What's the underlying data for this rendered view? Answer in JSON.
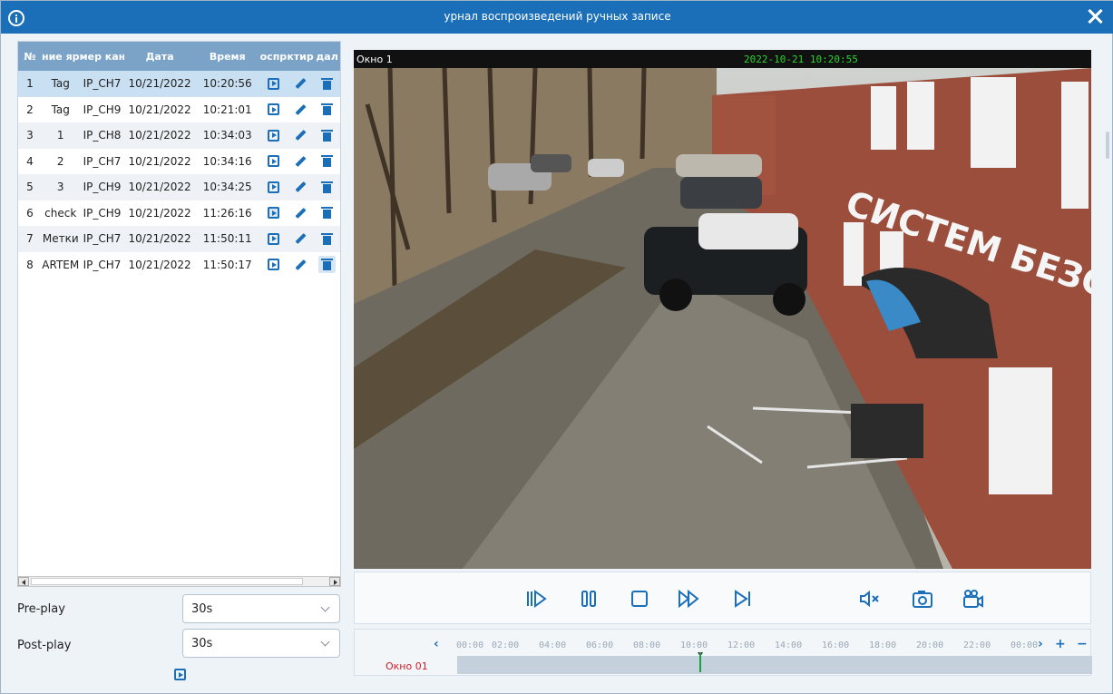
{
  "window": {
    "title": "урнал воспроизведений ручных записе"
  },
  "table": {
    "headers": {
      "num": "№",
      "name": "ние яр",
      "cam": "мер кана",
      "date": "Дата",
      "time": "Время",
      "play": "оспр",
      "edit": "ктирс",
      "del": "дал"
    },
    "rows": [
      {
        "num": "1",
        "name": "Tag",
        "cam": "IP_CH7",
        "date": "10/21/2022",
        "time": "10:20:56"
      },
      {
        "num": "2",
        "name": "Tag",
        "cam": "IP_CH9",
        "date": "10/21/2022",
        "time": "10:21:01"
      },
      {
        "num": "3",
        "name": "1",
        "cam": "IP_CH8",
        "date": "10/21/2022",
        "time": "10:34:03"
      },
      {
        "num": "4",
        "name": "2",
        "cam": "IP_CH7",
        "date": "10/21/2022",
        "time": "10:34:16"
      },
      {
        "num": "5",
        "name": "3",
        "cam": "IP_CH9",
        "date": "10/21/2022",
        "time": "10:34:25"
      },
      {
        "num": "6",
        "name": "check",
        "cam": "IP_CH9",
        "date": "10/21/2022",
        "time": "11:26:16"
      },
      {
        "num": "7",
        "name": "Метки",
        "cam": "IP_CH7",
        "date": "10/21/2022",
        "time": "11:50:11"
      },
      {
        "num": "8",
        "name": "ARTEM",
        "cam": "IP_CH7",
        "date": "10/21/2022",
        "time": "11:50:17"
      }
    ]
  },
  "options": {
    "preplay_label": "Pre-play",
    "preplay_value": "30s",
    "postplay_label": "Post-play",
    "postplay_value": "30s"
  },
  "video": {
    "window_title": "Окно 1",
    "timestamp": "2022-10-21 10:20:55"
  },
  "timeline": {
    "ticks": [
      "00:00",
      "02:00",
      "04:00",
      "06:00",
      "08:00",
      "10:00",
      "12:00",
      "14:00",
      "16:00",
      "18:00",
      "20:00",
      "22:00",
      "00:00"
    ],
    "channel": "Окно 01",
    "plus": "+",
    "minus": "−",
    "prev": "‹",
    "next": "›"
  },
  "colors": {
    "accent": "#1a6fb8",
    "header": "#7ba3c8",
    "timestamp": "#2dd12d",
    "channel": "#c8202a",
    "marker": "#18a040"
  }
}
